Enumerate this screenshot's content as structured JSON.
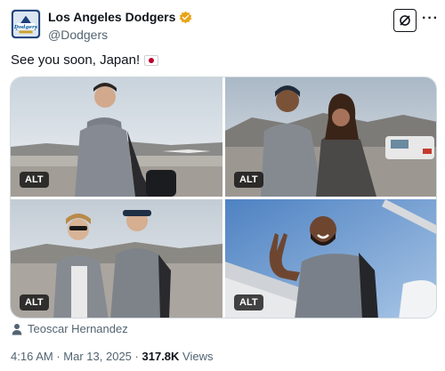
{
  "author": {
    "display_name": "Los Angeles Dodgers",
    "handle": "@Dodgers",
    "avatar_icon": "dodgers-world-champions-logo",
    "verified_color": "#e8a317"
  },
  "actions": {
    "grok_icon": "grok-icon",
    "more_label": "···"
  },
  "tweet": {
    "text": "See you soon, Japan!",
    "emoji": "japan-flag"
  },
  "media": {
    "alt_badge": "ALT",
    "photos": [
      {
        "alt_label": "ALT"
      },
      {
        "alt_label": "ALT"
      },
      {
        "alt_label": "ALT"
      },
      {
        "alt_label": "ALT"
      }
    ]
  },
  "tagged_user": "Teoscar Hernandez",
  "meta": {
    "time": "4:16 AM",
    "date": "Mar 13, 2025",
    "separator": "·",
    "views_count": "317.8K",
    "views_label": "Views"
  },
  "colors": {
    "text": "#0f1419",
    "secondary": "#536471",
    "dodger_blue": "#005a9c"
  }
}
